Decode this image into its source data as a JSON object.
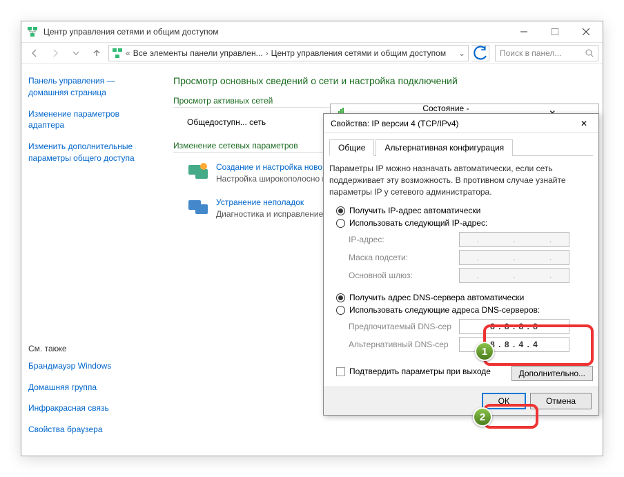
{
  "window": {
    "title": "Центр управления сетями и общим доступом"
  },
  "breadcrumb": {
    "item1": "Все элементы панели управлен...",
    "item2": "Центр управления сетями и общим доступом",
    "search_placeholder": "Поиск в панел..."
  },
  "sidebar": {
    "home": "Панель управления — домашняя страница",
    "link1": "Изменение параметров адаптера",
    "link2": "Изменить дополнительные параметры общего доступа",
    "see_also": "См. также",
    "sa1": "Брандмауэр Windows",
    "sa2": "Домашняя группа",
    "sa3": "Инфракрасная связь",
    "sa4": "Свойства браузера"
  },
  "main": {
    "heading": "Просмотр основных сведений о сети и настройка подключений",
    "sec1": "Просмотр активных сетей",
    "net_label": "Общедоступн... сеть",
    "sec2": "Изменение сетевых параметров",
    "item1_title": "Создание и настройка новог",
    "item1_desc": "Настройка широкополосно маршрутизатора или точки",
    "item2_title": "Устранение неполадок",
    "item2_desc": "Диагностика и исправление неполадок."
  },
  "status_dialog": {
    "title": "Состояние - Беспроводная сеть"
  },
  "dlg": {
    "title": "Свойства: IP версии 4 (TCP/IPv4)",
    "tab1": "Общие",
    "tab2": "Альтернативная конфигурация",
    "info": "Параметры IP можно назначать автоматически, если сеть поддерживает эту возможность. В противном случае узнайте параметры IP у сетевого администратора.",
    "radio_ip_auto": "Получить IP-адрес автоматически",
    "radio_ip_manual": "Использовать следующий IP-адрес:",
    "lbl_ip": "IP-адрес:",
    "lbl_mask": "Маска подсети:",
    "lbl_gw": "Основной шлюз:",
    "radio_dns_auto": "Получить адрес DNS-сервера автоматически",
    "radio_dns_manual": "Использовать следующие адреса DNS-серверов:",
    "lbl_dns1": "Предпочитаемый DNS-сер",
    "lbl_dns2": "Альтернативный DNS-сер",
    "dns1": "8 . 8 . 8 . 8",
    "dns2": "8 . 8 . 4 . 4",
    "chk_confirm": "Подтвердить параметры при выходе",
    "btn_adv": "Дополнительно...",
    "btn_ok": "ОК",
    "btn_cancel": "Отмена"
  },
  "badges": {
    "b1": "1",
    "b2": "2"
  }
}
